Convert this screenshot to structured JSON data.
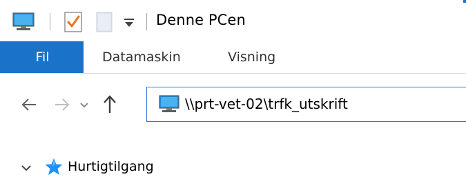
{
  "window": {
    "title": "Denne PCen"
  },
  "quick_access_toolbar": {
    "icons": [
      "this-pc-icon",
      "properties-icon",
      "new-folder-icon",
      "customize-dropdown-icon"
    ]
  },
  "ribbon": {
    "tabs": [
      {
        "label": "Fil",
        "active": true
      },
      {
        "label": "Datamaskin",
        "active": false
      },
      {
        "label": "Visning",
        "active": false
      }
    ]
  },
  "navigation": {
    "address": "\\\\prt-vet-02\\trfk_utskrift",
    "buttons": [
      "back-arrow-icon",
      "forward-arrow-icon",
      "recent-locations-icon",
      "up-arrow-icon"
    ]
  },
  "nav_pane": {
    "items": [
      {
        "label": "Hurtigtilgang",
        "icon": "star-icon",
        "expanded": true
      }
    ]
  },
  "colors": {
    "accent": "#1a73c8",
    "address_border": "#2c7ad6",
    "star": "#1e90ff"
  }
}
